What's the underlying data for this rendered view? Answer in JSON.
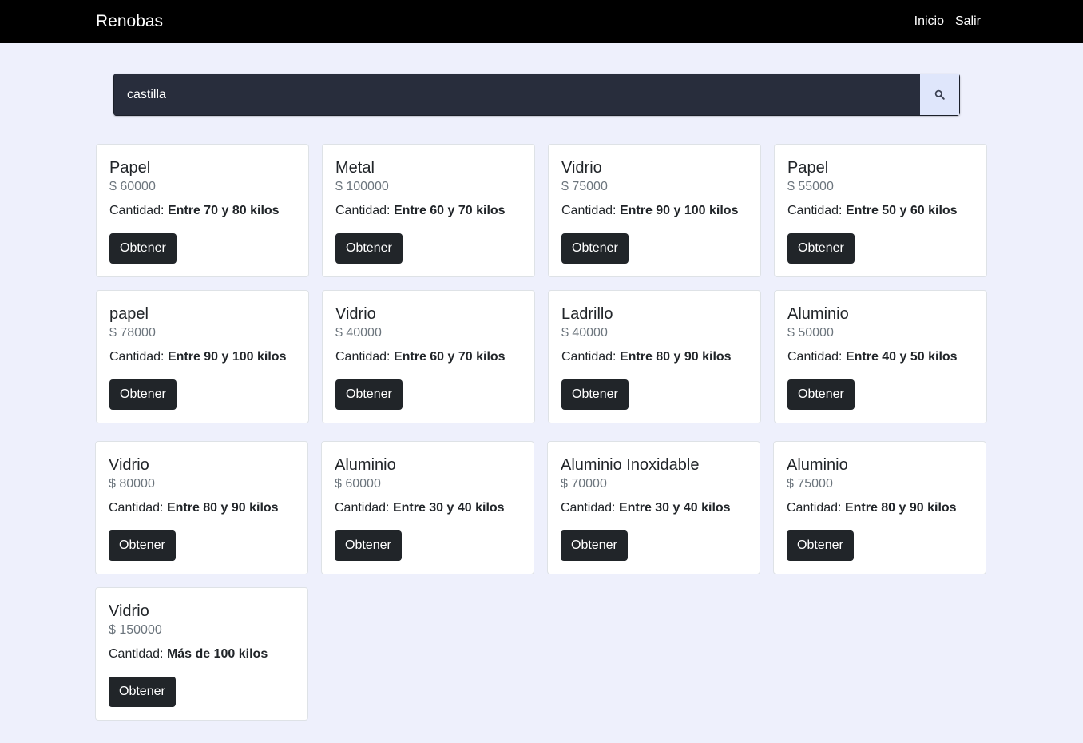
{
  "navbar": {
    "brand": "Renobas",
    "links": [
      "Inicio",
      "Salir"
    ]
  },
  "search": {
    "value": "castilla",
    "button_icon": "search-icon"
  },
  "cards": [
    {
      "title": "Papel",
      "price": "$ 60000",
      "qty_label": "Cantidad: ",
      "qty_value": "Entre 70 y 80 kilos",
      "button": "Obtener"
    },
    {
      "title": "Metal",
      "price": "$ 100000",
      "qty_label": "Cantidad: ",
      "qty_value": "Entre 60 y 70 kilos",
      "button": "Obtener"
    },
    {
      "title": "Vidrio",
      "price": "$ 75000",
      "qty_label": "Cantidad: ",
      "qty_value": "Entre 90 y 100 kilos",
      "button": "Obtener"
    },
    {
      "title": "Papel",
      "price": "$ 55000",
      "qty_label": "Cantidad: ",
      "qty_value": "Entre 50 y 60 kilos",
      "button": "Obtener"
    },
    {
      "title": "papel",
      "price": "$ 78000",
      "qty_label": "Cantidad: ",
      "qty_value": "Entre 90 y 100 kilos",
      "button": "Obtener"
    },
    {
      "title": "Vidrio",
      "price": "$ 40000",
      "qty_label": "Cantidad: ",
      "qty_value": "Entre 60 y 70 kilos",
      "button": "Obtener"
    },
    {
      "title": "Ladrillo",
      "price": "$ 40000",
      "qty_label": "Cantidad: ",
      "qty_value": "Entre 80 y 90 kilos",
      "button": "Obtener"
    },
    {
      "title": "Aluminio",
      "price": "$ 50000",
      "qty_label": "Cantidad: ",
      "qty_value": "Entre 40 y 50 kilos",
      "button": "Obtener"
    },
    {
      "title": "Vidrio",
      "price": "$ 80000",
      "qty_label": "Cantidad: ",
      "qty_value": "Entre 80 y 90 kilos",
      "button": "Obtener"
    },
    {
      "title": "Aluminio",
      "price": "$ 60000",
      "qty_label": "Cantidad: ",
      "qty_value": "Entre 30 y 40 kilos",
      "button": "Obtener"
    },
    {
      "title": "Aluminio Inoxidable",
      "price": "$ 70000",
      "qty_label": "Cantidad: ",
      "qty_value": "Entre 30 y 40 kilos",
      "button": "Obtener"
    },
    {
      "title": "Aluminio",
      "price": "$ 75000",
      "qty_label": "Cantidad: ",
      "qty_value": "Entre 80 y 90 kilos",
      "button": "Obtener"
    },
    {
      "title": "Vidrio",
      "price": "$ 150000",
      "qty_label": "Cantidad: ",
      "qty_value": "Más de 100 kilos",
      "button": "Obtener"
    }
  ]
}
